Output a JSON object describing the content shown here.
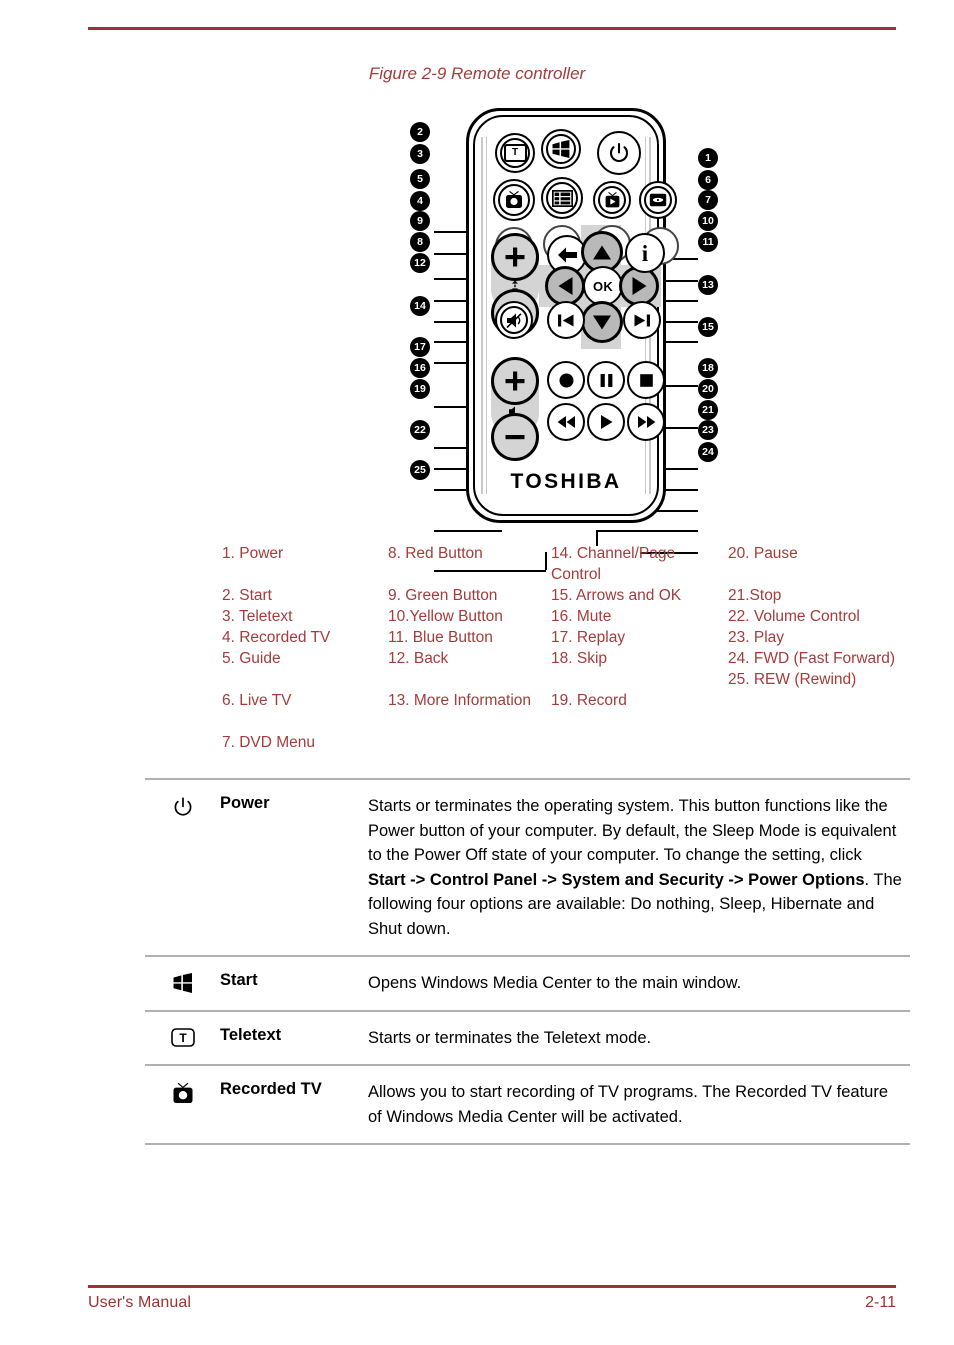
{
  "figure": {
    "caption": "Figure 2-9 Remote controller",
    "brand": "TOSHIBA",
    "ok_label": "OK",
    "teletext_glyph": "T",
    "info_glyph": "i",
    "callouts_left": [
      "2",
      "3",
      "5",
      "4",
      "9",
      "8",
      "12",
      "14",
      "17",
      "16",
      "19",
      "22",
      "25"
    ],
    "callouts_right": [
      "1",
      "6",
      "7",
      "10",
      "11",
      "13",
      "15",
      "18",
      "20",
      "21",
      "23",
      "24"
    ]
  },
  "legend": {
    "col1": [
      "1. Power",
      "",
      "2. Start",
      "3. Teletext",
      "4. Recorded TV",
      "5. Guide",
      "",
      "6. Live TV",
      "",
      "7. DVD Menu"
    ],
    "col2": [
      "8. Red Button",
      "",
      "9. Green Button",
      "10.Yellow Button",
      "11. Blue Button",
      "12. Back",
      "",
      "13. More Information"
    ],
    "col3": [
      "14. Channel/Page Control",
      "15. Arrows and OK",
      "16. Mute",
      "17. Replay",
      "18. Skip",
      "",
      "19. Record"
    ],
    "col4": [
      "20. Pause",
      "",
      "21.Stop",
      "22. Volume Control",
      "23. Play",
      "24. FWD (Fast Forward)",
      "25. REW (Rewind)"
    ]
  },
  "descriptions": [
    {
      "icon": "power-icon",
      "name": "Power",
      "text_parts": [
        {
          "bold": false,
          "t": "Starts or terminates the operating system. This button functions like the Power button of your computer. By default, the Sleep Mode is equivalent to the Power Off state of your computer. To change the setting, click "
        },
        {
          "bold": true,
          "t": "Start -> Control Panel -> System and Security -> Power Options"
        },
        {
          "bold": false,
          "t": ". The following four options are available: Do nothing, Sleep, Hibernate and Shut down."
        }
      ]
    },
    {
      "icon": "windows-start-icon",
      "name": "Start",
      "text_parts": [
        {
          "bold": false,
          "t": "Opens Windows Media Center to the main window."
        }
      ]
    },
    {
      "icon": "teletext-icon",
      "name": "Teletext",
      "text_parts": [
        {
          "bold": false,
          "t": "Starts or terminates the Teletext mode."
        }
      ]
    },
    {
      "icon": "recorded-tv-icon",
      "name": "Recorded TV",
      "text_parts": [
        {
          "bold": false,
          "t": "Allows you to start recording of TV programs. The Recorded TV feature of Windows Media Center will be activated."
        }
      ]
    }
  ],
  "footer": {
    "left": "User's Manual",
    "right": "2-11"
  },
  "colors": {
    "accent_red": "#9c3232",
    "legend_red": "#a43c3c",
    "rule_grey": "#b0b0b0",
    "pad_grey": "#d4d4d4"
  }
}
